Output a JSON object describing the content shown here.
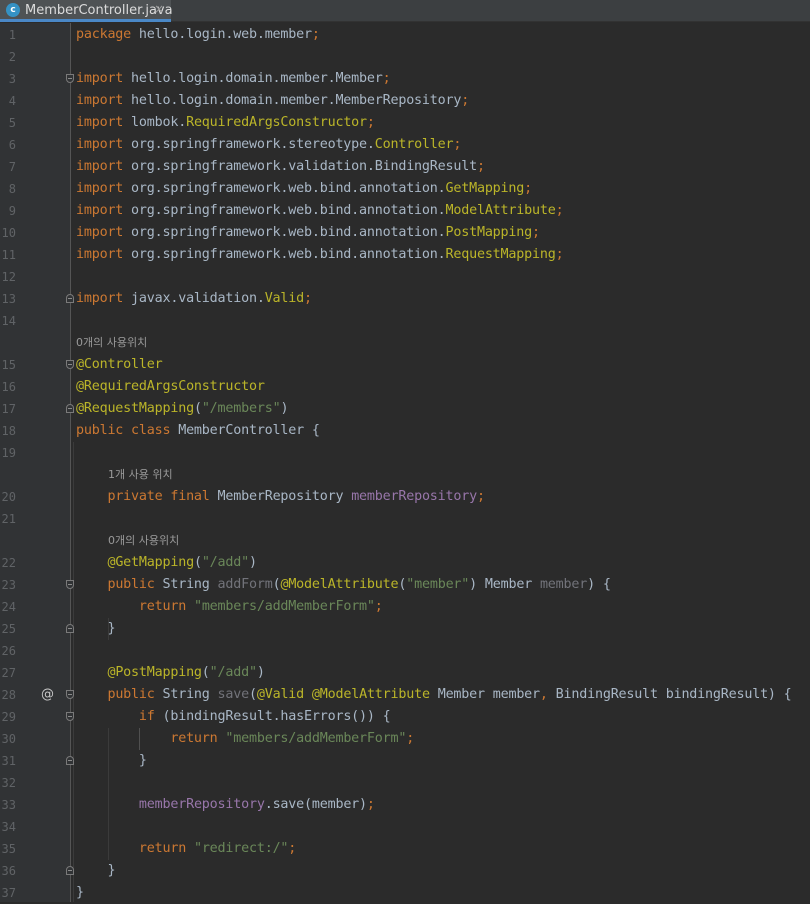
{
  "tab": {
    "icon_letter": "c",
    "icon": "class-c-icon",
    "filename": "MemberController.java",
    "close": "×"
  },
  "colors": {
    "background": "#2b2b2b",
    "gutter": "#313335",
    "keyword": "#cc7832",
    "annotation": "#bbb529",
    "string": "#6a8759",
    "field": "#9876aa",
    "text": "#a9b7c6"
  },
  "editor": {
    "lines": [
      {
        "n": "1",
        "tokens": [
          {
            "t": "package",
            "c": "kw"
          },
          {
            "t": " hello.login.web.member",
            "c": "plain"
          },
          {
            "t": ";",
            "c": "kw"
          }
        ]
      },
      {
        "n": "2",
        "tokens": []
      },
      {
        "n": "3",
        "fold": "s",
        "tokens": [
          {
            "t": "import",
            "c": "kw"
          },
          {
            "t": " hello.login.domain.member.Member",
            "c": "plain"
          },
          {
            "t": ";",
            "c": "kw"
          }
        ]
      },
      {
        "n": "4",
        "tokens": [
          {
            "t": "import",
            "c": "kw"
          },
          {
            "t": " hello.login.domain.member.MemberRepository",
            "c": "plain"
          },
          {
            "t": ";",
            "c": "kw"
          }
        ]
      },
      {
        "n": "5",
        "tokens": [
          {
            "t": "import",
            "c": "kw"
          },
          {
            "t": " lombok.",
            "c": "plain"
          },
          {
            "t": "RequiredArgsConstructor",
            "c": "ann"
          },
          {
            "t": ";",
            "c": "kw"
          }
        ]
      },
      {
        "n": "6",
        "tokens": [
          {
            "t": "import",
            "c": "kw"
          },
          {
            "t": " org.springframework.stereotype.",
            "c": "plain"
          },
          {
            "t": "Controller",
            "c": "ann"
          },
          {
            "t": ";",
            "c": "kw"
          }
        ]
      },
      {
        "n": "7",
        "tokens": [
          {
            "t": "import",
            "c": "kw"
          },
          {
            "t": " org.springframework.validation.BindingResult",
            "c": "plain"
          },
          {
            "t": ";",
            "c": "kw"
          }
        ]
      },
      {
        "n": "8",
        "tokens": [
          {
            "t": "import",
            "c": "kw"
          },
          {
            "t": " org.springframework.web.bind.annotation.",
            "c": "plain"
          },
          {
            "t": "GetMapping",
            "c": "ann"
          },
          {
            "t": ";",
            "c": "kw"
          }
        ]
      },
      {
        "n": "9",
        "tokens": [
          {
            "t": "import",
            "c": "kw"
          },
          {
            "t": " org.springframework.web.bind.annotation.",
            "c": "plain"
          },
          {
            "t": "ModelAttribute",
            "c": "ann"
          },
          {
            "t": ";",
            "c": "kw"
          }
        ]
      },
      {
        "n": "10",
        "tokens": [
          {
            "t": "import",
            "c": "kw"
          },
          {
            "t": " org.springframework.web.bind.annotation.",
            "c": "plain"
          },
          {
            "t": "PostMapping",
            "c": "ann"
          },
          {
            "t": ";",
            "c": "kw"
          }
        ]
      },
      {
        "n": "11",
        "tokens": [
          {
            "t": "import",
            "c": "kw"
          },
          {
            "t": " org.springframework.web.bind.annotation.",
            "c": "plain"
          },
          {
            "t": "RequestMapping",
            "c": "ann"
          },
          {
            "t": ";",
            "c": "kw"
          }
        ]
      },
      {
        "n": "12",
        "tokens": []
      },
      {
        "n": "13",
        "fold": "e",
        "tokens": [
          {
            "t": "import",
            "c": "kw"
          },
          {
            "t": " javax.validation.",
            "c": "plain"
          },
          {
            "t": "Valid",
            "c": "ann"
          },
          {
            "t": ";",
            "c": "kw"
          }
        ]
      },
      {
        "n": "14",
        "tokens": []
      },
      {
        "hint": "0개의 사용위치",
        "indent": 0
      },
      {
        "n": "15",
        "fold": "s",
        "tokens": [
          {
            "t": "@Controller",
            "c": "ann"
          }
        ]
      },
      {
        "n": "16",
        "tokens": [
          {
            "t": "@RequiredArgsConstructor",
            "c": "ann"
          }
        ]
      },
      {
        "n": "17",
        "fold": "e",
        "tokens": [
          {
            "t": "@RequestMapping",
            "c": "ann"
          },
          {
            "t": "(",
            "c": "plain"
          },
          {
            "t": "\"/members\"",
            "c": "str"
          },
          {
            "t": ")",
            "c": "plain"
          }
        ]
      },
      {
        "n": "18",
        "tokens": [
          {
            "t": "public class",
            "c": "kw"
          },
          {
            "t": " MemberController {",
            "c": "plain"
          }
        ]
      },
      {
        "n": "19",
        "tokens": []
      },
      {
        "hint": "1개 사용 위치",
        "indent": 1
      },
      {
        "n": "20",
        "tokens": [
          {
            "t": "    ",
            "c": "plain"
          },
          {
            "t": "private final",
            "c": "kw"
          },
          {
            "t": " MemberRepository ",
            "c": "plain"
          },
          {
            "t": "memberRepository",
            "c": "fld"
          },
          {
            "t": ";",
            "c": "kw"
          }
        ]
      },
      {
        "n": "21",
        "tokens": []
      },
      {
        "hint": "0개의 사용위치",
        "indent": 1
      },
      {
        "n": "22",
        "tokens": [
          {
            "t": "    ",
            "c": "plain"
          },
          {
            "t": "@GetMapping",
            "c": "ann"
          },
          {
            "t": "(",
            "c": "plain"
          },
          {
            "t": "\"/add\"",
            "c": "str"
          },
          {
            "t": ")",
            "c": "plain"
          }
        ]
      },
      {
        "n": "23",
        "fold": "s",
        "tokens": [
          {
            "t": "    ",
            "c": "plain"
          },
          {
            "t": "public",
            "c": "kw"
          },
          {
            "t": " String ",
            "c": "plain"
          },
          {
            "t": "addForm",
            "c": "gray"
          },
          {
            "t": "(",
            "c": "plain"
          },
          {
            "t": "@ModelAttribute",
            "c": "ann"
          },
          {
            "t": "(",
            "c": "plain"
          },
          {
            "t": "\"member\"",
            "c": "str"
          },
          {
            "t": ") Member ",
            "c": "plain"
          },
          {
            "t": "member",
            "c": "gray"
          },
          {
            "t": ") {",
            "c": "plain"
          }
        ]
      },
      {
        "n": "24",
        "tokens": [
          {
            "t": "        ",
            "c": "plain"
          },
          {
            "t": "return",
            "c": "kw"
          },
          {
            "t": " ",
            "c": "plain"
          },
          {
            "t": "\"members/addMemberForm\"",
            "c": "str"
          },
          {
            "t": ";",
            "c": "kw"
          }
        ]
      },
      {
        "n": "25",
        "fold": "e",
        "tokens": [
          {
            "t": "    }",
            "c": "plain"
          }
        ]
      },
      {
        "n": "26",
        "tokens": []
      },
      {
        "n": "27",
        "tokens": [
          {
            "t": "    ",
            "c": "plain"
          },
          {
            "t": "@PostMapping",
            "c": "ann"
          },
          {
            "t": "(",
            "c": "plain"
          },
          {
            "t": "\"/add\"",
            "c": "str"
          },
          {
            "t": ")",
            "c": "plain"
          }
        ]
      },
      {
        "n": "28",
        "icon": "@",
        "fold": "s",
        "tokens": [
          {
            "t": "    ",
            "c": "plain"
          },
          {
            "t": "public",
            "c": "kw"
          },
          {
            "t": " String ",
            "c": "plain"
          },
          {
            "t": "save",
            "c": "gray"
          },
          {
            "t": "(",
            "c": "plain"
          },
          {
            "t": "@Valid",
            "c": "ann"
          },
          {
            "t": " ",
            "c": "plain"
          },
          {
            "t": "@ModelAttribute",
            "c": "ann"
          },
          {
            "t": " Member member",
            "c": "plain"
          },
          {
            "t": ", ",
            "c": "kw"
          },
          {
            "t": "BindingResult bindingResult) {",
            "c": "plain"
          }
        ]
      },
      {
        "n": "29",
        "fold": "s",
        "tokens": [
          {
            "t": "        ",
            "c": "plain"
          },
          {
            "t": "if",
            "c": "kw"
          },
          {
            "t": " (bindingResult.hasErrors()) {",
            "c": "plain"
          }
        ]
      },
      {
        "n": "30",
        "tokens": [
          {
            "t": "            ",
            "c": "plain"
          },
          {
            "t": "return",
            "c": "kw"
          },
          {
            "t": " ",
            "c": "plain"
          },
          {
            "t": "\"members/addMemberForm\"",
            "c": "str"
          },
          {
            "t": ";",
            "c": "kw"
          }
        ]
      },
      {
        "n": "31",
        "fold": "e",
        "tokens": [
          {
            "t": "        }",
            "c": "plain"
          }
        ]
      },
      {
        "n": "32",
        "tokens": []
      },
      {
        "n": "33",
        "tokens": [
          {
            "t": "        ",
            "c": "plain"
          },
          {
            "t": "memberRepository",
            "c": "fld"
          },
          {
            "t": ".save(member)",
            "c": "plain"
          },
          {
            "t": ";",
            "c": "kw"
          }
        ]
      },
      {
        "n": "34",
        "tokens": []
      },
      {
        "n": "35",
        "tokens": [
          {
            "t": "        ",
            "c": "plain"
          },
          {
            "t": "return",
            "c": "kw"
          },
          {
            "t": " ",
            "c": "plain"
          },
          {
            "t": "\"redirect:/\"",
            "c": "str"
          },
          {
            "t": ";",
            "c": "kw"
          }
        ]
      },
      {
        "n": "36",
        "fold": "e",
        "tokens": [
          {
            "t": "    }",
            "c": "plain"
          }
        ]
      },
      {
        "n": "37",
        "tokens": [
          {
            "t": "}",
            "c": "plain"
          }
        ]
      }
    ]
  }
}
